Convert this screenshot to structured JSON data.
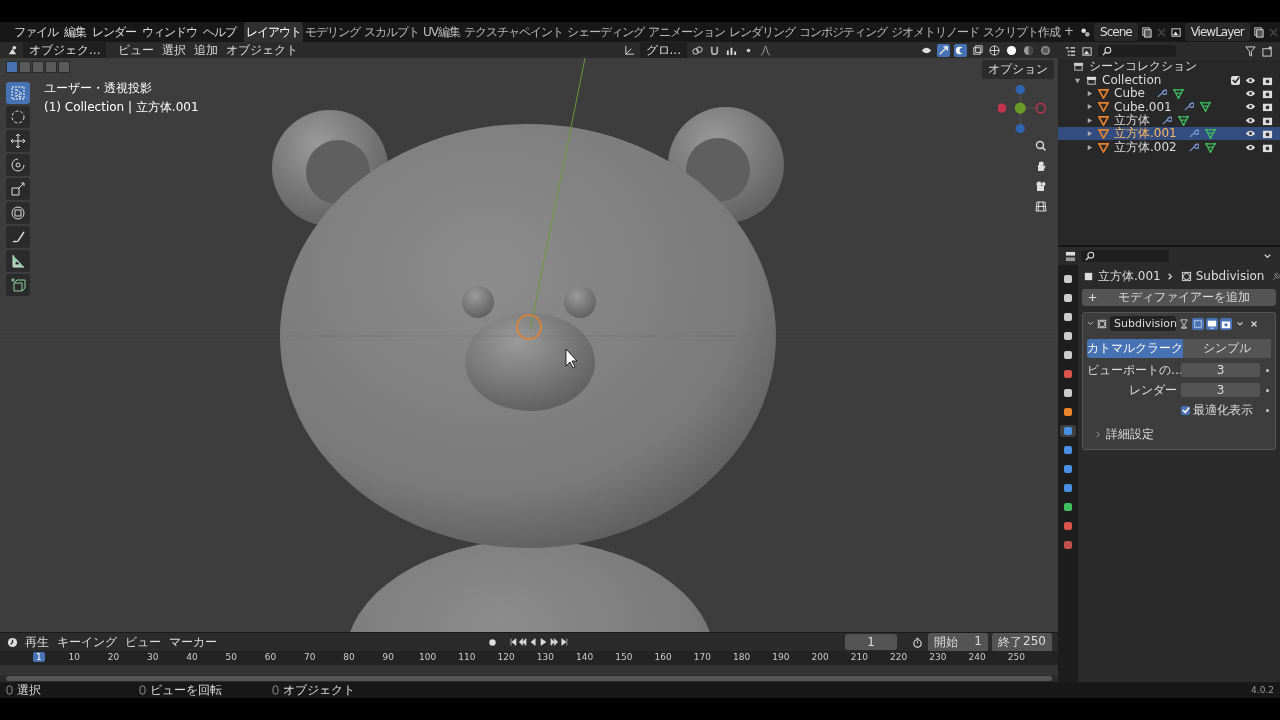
{
  "menu_bar": {
    "menus": [
      "ファイル",
      "編集",
      "レンダー",
      "ウィンドウ",
      "ヘルプ"
    ],
    "workspaces": [
      {
        "label": "レイアウト",
        "selected": true
      },
      {
        "label": "モデリング",
        "selected": false
      },
      {
        "label": "スカルプト",
        "selected": false
      },
      {
        "label": "UV編集",
        "selected": false
      },
      {
        "label": "テクスチャペイント",
        "selected": false
      },
      {
        "label": "シェーディング",
        "selected": false
      },
      {
        "label": "アニメーション",
        "selected": false
      },
      {
        "label": "レンダリング",
        "selected": false
      },
      {
        "label": "コンポジティング",
        "selected": false
      },
      {
        "label": "ジオメトリノード",
        "selected": false
      },
      {
        "label": "スクリプト作成",
        "selected": false
      }
    ],
    "add_workspace": "+",
    "scene": "Scene",
    "view_layer": "ViewLayer"
  },
  "viewport": {
    "mode": "オブジェク...",
    "menus": [
      "ビュー",
      "選択",
      "追加",
      "オブジェクト"
    ],
    "orientation": "グロ...",
    "options": "オプション",
    "view_name": "ユーザー・透視投影",
    "object_info": "(1) Collection | 立方体.001",
    "select_modes": [
      {
        "selected": true
      },
      {
        "selected": false
      },
      {
        "selected": false
      },
      {
        "selected": false
      },
      {
        "selected": false
      }
    ],
    "tools": [
      {
        "kind": "select",
        "selected": true
      },
      {
        "kind": "cursor",
        "selected": false
      },
      {
        "kind": "move",
        "selected": false
      },
      {
        "kind": "rotate",
        "selected": false
      },
      {
        "kind": "scale",
        "selected": false
      },
      {
        "kind": "transform",
        "selected": false
      },
      {
        "kind": "annotate",
        "selected": false
      },
      {
        "kind": "measure",
        "selected": false
      },
      {
        "kind": "add-cube",
        "selected": false
      }
    ]
  },
  "outliner": {
    "root": "シーンコレクション",
    "collections": [
      {
        "name": "Collection",
        "expanded": true,
        "checked": true,
        "children": [
          {
            "name": "Cube",
            "expanded": false,
            "selected": false
          },
          {
            "name": "Cube.001",
            "expanded": false,
            "selected": false
          },
          {
            "name": "立方体",
            "expanded": false,
            "selected": false
          },
          {
            "name": "立方体.001",
            "expanded": false,
            "selected": true
          },
          {
            "name": "立方体.002",
            "expanded": false,
            "selected": false
          }
        ]
      }
    ]
  },
  "properties": {
    "breadcrumb": [
      "立方体.001",
      "Subdivision"
    ],
    "add_modifier": "モディファイアーを追加",
    "tabs": [
      {
        "color": "#cccccc",
        "selected": false
      },
      {
        "color": "#cccccc",
        "selected": false
      },
      {
        "color": "#cccccc",
        "selected": false
      },
      {
        "color": "#cccccc",
        "selected": false
      },
      {
        "color": "#cccccc",
        "selected": false
      },
      {
        "color": "#d9534f",
        "selected": false
      },
      {
        "color": "#cccccc",
        "selected": false
      },
      {
        "color": "#e8822a",
        "selected": false
      },
      {
        "color": "#4a90e2",
        "selected": true
      },
      {
        "color": "#4a90e2",
        "selected": false
      },
      {
        "color": "#4a90e2",
        "selected": false
      },
      {
        "color": "#4a90e2",
        "selected": false
      },
      {
        "color": "#3fbf5f",
        "selected": false
      },
      {
        "color": "#d9534f",
        "selected": false
      },
      {
        "color": "#c0504d",
        "selected": false
      }
    ],
    "modifier": {
      "name": "Subdivision",
      "expanded": true,
      "types": [
        {
          "label": "カトマルクラーク",
          "selected": true
        },
        {
          "label": "シンプル",
          "selected": false
        }
      ],
      "fields": [
        {
          "label": "ビューポートの…",
          "value": "3"
        },
        {
          "label": "レンダー",
          "value": "3"
        }
      ],
      "optimal_display": {
        "label": "最適化表示",
        "checked": true
      },
      "advanced": "詳細設定"
    }
  },
  "timeline": {
    "menus": [
      "再生",
      "キーイング",
      "ビュー",
      "マーカー"
    ],
    "current_frame": "1",
    "start_label": "開始",
    "start": "1",
    "end_label": "終了",
    "end": "250",
    "playhead": "1",
    "ticks": [
      "10",
      "20",
      "30",
      "40",
      "50",
      "60",
      "70",
      "80",
      "90",
      "100",
      "110",
      "120",
      "130",
      "140",
      "150",
      "160",
      "170",
      "180",
      "190",
      "200",
      "210",
      "220",
      "230",
      "240",
      "250"
    ]
  },
  "status_bar": {
    "hints": [
      "選択",
      "ビューを回転",
      "オブジェクト"
    ],
    "version": "4.0.2"
  }
}
